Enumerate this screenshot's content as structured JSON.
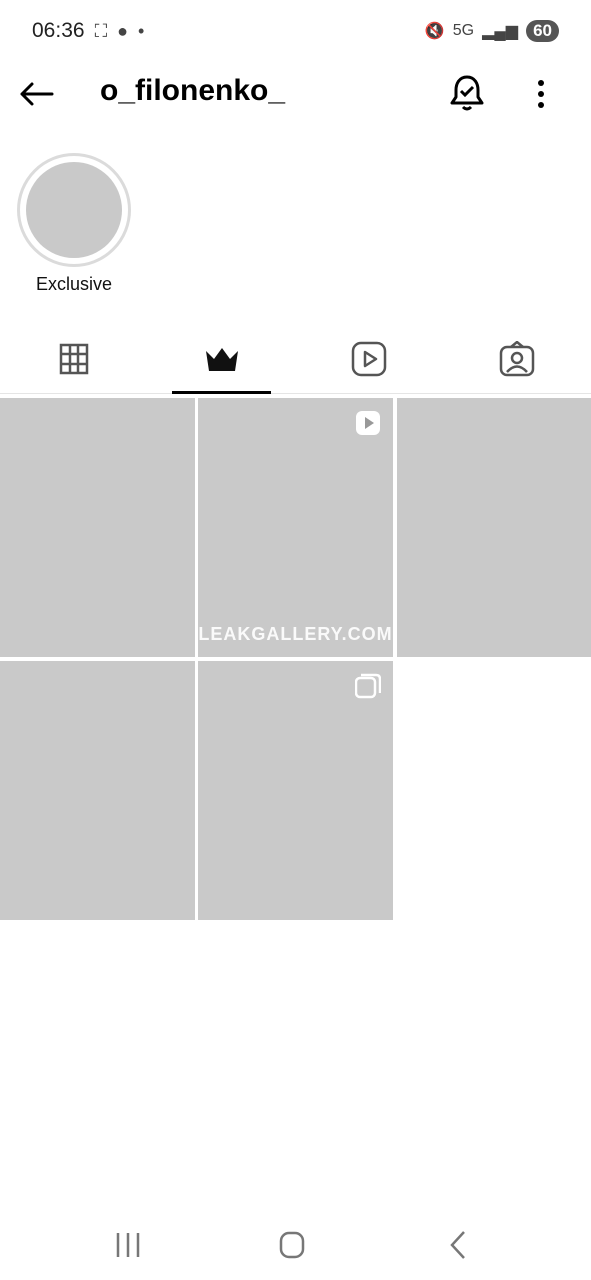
{
  "status": {
    "time": "06:36",
    "battery": "60",
    "network": "5G"
  },
  "header": {
    "username": "o_filonenko_"
  },
  "highlights": [
    {
      "label": "Exclusive"
    }
  ],
  "grid_watermark": "LEAKGALLERY.COM",
  "colors": {
    "placeholder": "#c9c9c9",
    "divider": "#e5e5e5"
  }
}
